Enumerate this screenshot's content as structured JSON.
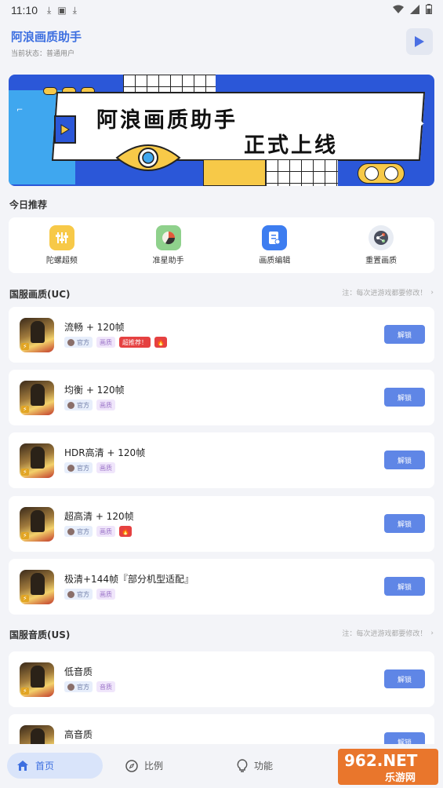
{
  "status_bar": {
    "time": "11:10",
    "icons": [
      "download-icon",
      "a-icon",
      "download-icon"
    ],
    "right_icons": [
      "wifi-icon",
      "signal-icon",
      "battery-icon"
    ]
  },
  "header": {
    "title": "阿浪画质助手",
    "subtitle": "当前状态：普通用户",
    "action_icon": "play-icon"
  },
  "banner": {
    "line1": "阿浪画质助手",
    "line2": "正式上线"
  },
  "today": {
    "title": "今日推荐",
    "tools": [
      {
        "label": "陀螺超频",
        "icon": "sliders-icon",
        "color": "#f7c948"
      },
      {
        "label": "准星助手",
        "icon": "pie-icon",
        "color": "#8fd18c"
      },
      {
        "label": "画质编辑",
        "icon": "document-edit-icon",
        "color": "#3d7df0"
      },
      {
        "label": "重置画质",
        "icon": "share-icon",
        "color": "#e8ecf3"
      }
    ]
  },
  "section_uc": {
    "title": "国服画质(UC)",
    "note": "注：每次进游戏都要修改！",
    "items": [
      {
        "title": "流畅 + 120帧",
        "official": "官方",
        "type": "画质",
        "hot": "超推荐！",
        "fire": true,
        "button": "解锁"
      },
      {
        "title": "均衡 + 120帧",
        "official": "官方",
        "type": "画质",
        "button": "解锁"
      },
      {
        "title": "HDR高清 + 120帧",
        "official": "官方",
        "type": "画质",
        "button": "解锁"
      },
      {
        "title": "超高清 + 120帧",
        "official": "官方",
        "type": "画质",
        "fire": true,
        "button": "解锁"
      },
      {
        "title": "极清+144帧『部分机型适配』",
        "official": "官方",
        "type": "画质",
        "button": "解锁"
      }
    ]
  },
  "section_us": {
    "title": "国服音质(US)",
    "note": "注：每次进游戏都要修改！",
    "items": [
      {
        "title": "低音质",
        "official": "官方",
        "type": "音质",
        "button": "解锁"
      },
      {
        "title": "高音质",
        "button": "解锁"
      }
    ]
  },
  "nav": {
    "home": "首页",
    "ratio": "比例",
    "function": "功能"
  },
  "watermark": {
    "top": "962.NET",
    "bottom": "乐游网"
  },
  "colors": {
    "accent": "#3d6fe0",
    "unlock": "#5f86e6",
    "hot": "#e54141",
    "banner_blue": "#2b57d8"
  }
}
